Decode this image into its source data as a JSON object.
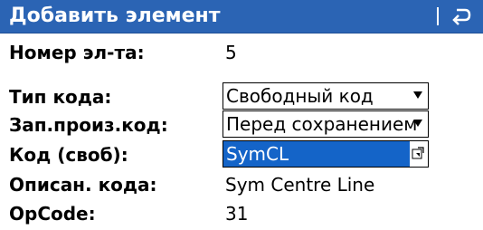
{
  "titlebar": {
    "title": "Добавить элемент",
    "back_icon": "undo-arrow-icon"
  },
  "fields": {
    "element_number": {
      "label": "Номер эл-та:",
      "value": "5"
    },
    "code_type": {
      "label": "Тип кода:",
      "value": "Свободный код"
    },
    "prompt_code": {
      "label": "Зап.произ.код:",
      "value": "Перед сохранением"
    },
    "free_code": {
      "label": "Код (своб):",
      "value": "SymCL"
    },
    "code_description": {
      "label": "Описан. кода:",
      "value": "Sym Centre Line"
    },
    "opcode": {
      "label": "OpCode:",
      "value": "31"
    }
  },
  "colors": {
    "titlebar": "#2b64b4",
    "selection": "#1464c8"
  }
}
